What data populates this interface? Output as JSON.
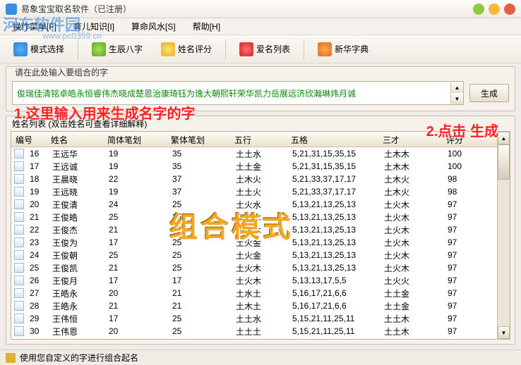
{
  "window": {
    "title": "易象宝宝取名软件（已注册）"
  },
  "menu": {
    "ops": "操作菜单[F]",
    "child": "育儿知识[I]",
    "fengshui": "算命风水[S]",
    "help": "帮助[H]"
  },
  "toolbar": {
    "mode": "模式选择",
    "bazi": "生辰八字",
    "score": "姓名评分",
    "favlist": "爱名列表",
    "dict": "新华字典"
  },
  "input_group": {
    "label": "请在此处输入要组合的字",
    "value": "俊瑞佳清铭卓皓永恒睿伟杰晓成楚恩治康琦钰为逸大朝熙轩荣华凯力岳展远济欣瀚琳炜月诚"
  },
  "gen_btn": "生成",
  "anno": {
    "a1": "1.这里输入用来生成名字的字",
    "a2": "2.点击 生成",
    "a3": "组合模式"
  },
  "list_group": {
    "label": "姓名列表 (双击姓名可查看详细解释)"
  },
  "columns": {
    "id": "编号",
    "name": "姓名",
    "simp": "简体笔划",
    "trad": "繁体笔划",
    "wuxing": "五行",
    "wuge": "五格",
    "sancai": "三才",
    "score": "评分"
  },
  "rows": [
    {
      "id": "16",
      "name": "王远华",
      "simp": "19",
      "trad": "35",
      "wuxing": "土土水",
      "wuge": "5,21,31,15,35,15",
      "sancai": "土木木",
      "score": "100"
    },
    {
      "id": "17",
      "name": "王远诚",
      "simp": "19",
      "trad": "35",
      "wuxing": "土土金",
      "wuge": "5,21,31,15,35,15",
      "sancai": "土木木",
      "score": "100"
    },
    {
      "id": "18",
      "name": "王晨晓",
      "simp": "22",
      "trad": "37",
      "wuxing": "土木火",
      "wuge": "5,21,33,37,17,17",
      "sancai": "土木火",
      "score": "98"
    },
    {
      "id": "19",
      "name": "王远晓",
      "simp": "19",
      "trad": "37",
      "wuxing": "土土火",
      "wuge": "5,21,33,37,17,17",
      "sancai": "土木火",
      "score": "98"
    },
    {
      "id": "20",
      "name": "王俊清",
      "simp": "24",
      "trad": "25",
      "wuxing": "土火水",
      "wuge": "5,13,21,13,25,13",
      "sancai": "土火木",
      "score": "97"
    },
    {
      "id": "21",
      "name": "王俊皓",
      "simp": "25",
      "trad": "25",
      "wuxing": "土火木",
      "wuge": "5,13,21,13,25,13",
      "sancai": "土火木",
      "score": "97"
    },
    {
      "id": "22",
      "name": "王俊杰",
      "simp": "21",
      "trad": "25",
      "wuxing": "土火木",
      "wuge": "5,13,21,13,25,13",
      "sancai": "土火木",
      "score": "97"
    },
    {
      "id": "23",
      "name": "王俊为",
      "simp": "17",
      "trad": "25",
      "wuxing": "土火金",
      "wuge": "5,13,21,13,25,13",
      "sancai": "土火木",
      "score": "97"
    },
    {
      "id": "24",
      "name": "王俊朝",
      "simp": "25",
      "trad": "25",
      "wuxing": "土火金",
      "wuge": "5,13,21,13,25,13",
      "sancai": "土火木",
      "score": "97"
    },
    {
      "id": "25",
      "name": "王俊凯",
      "simp": "21",
      "trad": "25",
      "wuxing": "土火木",
      "wuge": "5,13,21,13,25,13",
      "sancai": "土火木",
      "score": "97"
    },
    {
      "id": "26",
      "name": "王俊月",
      "simp": "17",
      "trad": "17",
      "wuxing": "土火木",
      "wuge": "5,13,13,17,5,5",
      "sancai": "土火火",
      "score": "97"
    },
    {
      "id": "27",
      "name": "王皓永",
      "simp": "20",
      "trad": "21",
      "wuxing": "土水土",
      "wuge": "5,16,17,21,6,6",
      "sancai": "土土金",
      "score": "97"
    },
    {
      "id": "28",
      "name": "王皓永",
      "simp": "21",
      "trad": "21",
      "wuxing": "土木土",
      "wuge": "5,16,17,21,6,6",
      "sancai": "土土金",
      "score": "97"
    },
    {
      "id": "29",
      "name": "王伟恒",
      "simp": "17",
      "trad": "25",
      "wuxing": "土土水",
      "wuge": "5,15,21,11,25,11",
      "sancai": "土土木",
      "score": "97"
    },
    {
      "id": "30",
      "name": "王伟恩",
      "simp": "20",
      "trad": "25",
      "wuxing": "土土土",
      "wuge": "5,15,21,11,25,11",
      "sancai": "土土木",
      "score": "97"
    }
  ],
  "status": "使用您自定义的字进行组合起名",
  "watermark": {
    "text": "河东软件园",
    "url": "www.pc0359.cn"
  }
}
